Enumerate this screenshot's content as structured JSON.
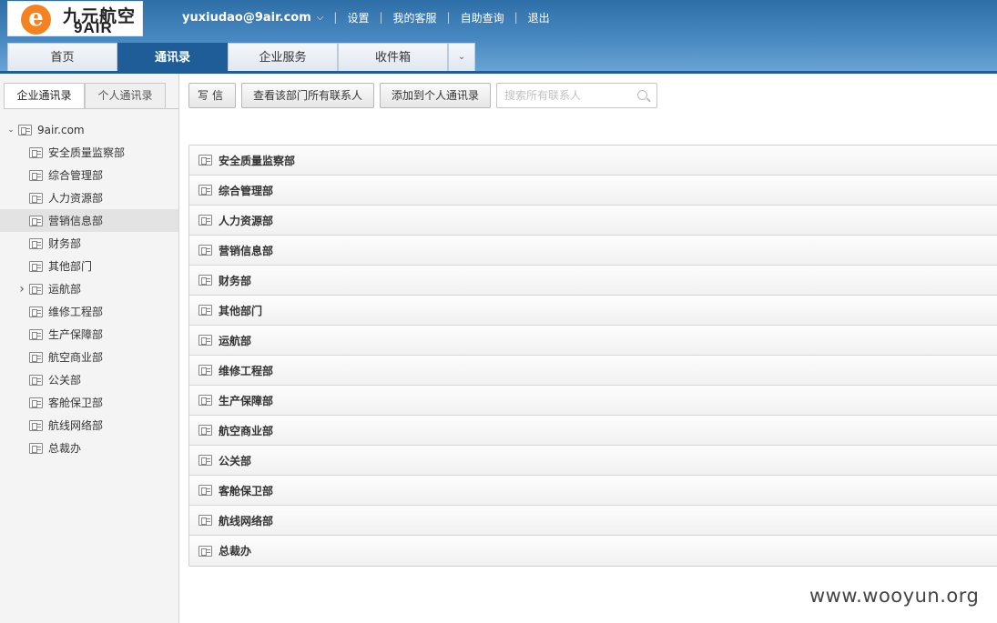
{
  "header": {
    "logo_cn": "九元航空",
    "logo_en": "9AIR",
    "user_email": "yuxiudao@9air.com",
    "links": [
      "设置",
      "我的客服",
      "自助查询",
      "退出"
    ]
  },
  "nav": {
    "tabs": [
      "首页",
      "通讯录",
      "企业服务",
      "收件箱"
    ],
    "active_tab": "通讯录"
  },
  "sidebar": {
    "tabs": [
      "企业通讯录",
      "个人通讯录"
    ],
    "root": "9air.com",
    "items": [
      "安全质量监察部",
      "综合管理部",
      "人力资源部",
      "营销信息部",
      "财务部",
      "其他部门",
      "运航部",
      "维修工程部",
      "生产保障部",
      "航空商业部",
      "公关部",
      "客舱保卫部",
      "航线网络部",
      "总裁办"
    ],
    "selected": "营销信息部",
    "expandable": "运航部"
  },
  "toolbar": {
    "write_label": "写信",
    "view_all_label": "查看该部门所有联系人",
    "add_personal_label": "添加到个人通讯录",
    "search_placeholder": "搜索所有联系人"
  },
  "departments": [
    "安全质量监察部",
    "综合管理部",
    "人力资源部",
    "营销信息部",
    "财务部",
    "其他部门",
    "运航部",
    "维修工程部",
    "生产保障部",
    "航空商业部",
    "公关部",
    "客舱保卫部",
    "航线网络部",
    "总裁办"
  ],
  "watermark": "www.wooyun.org",
  "colors": {
    "header_blue": "#2f6fa8",
    "active_tab": "#1f5d98",
    "logo_orange": "#f58220"
  }
}
